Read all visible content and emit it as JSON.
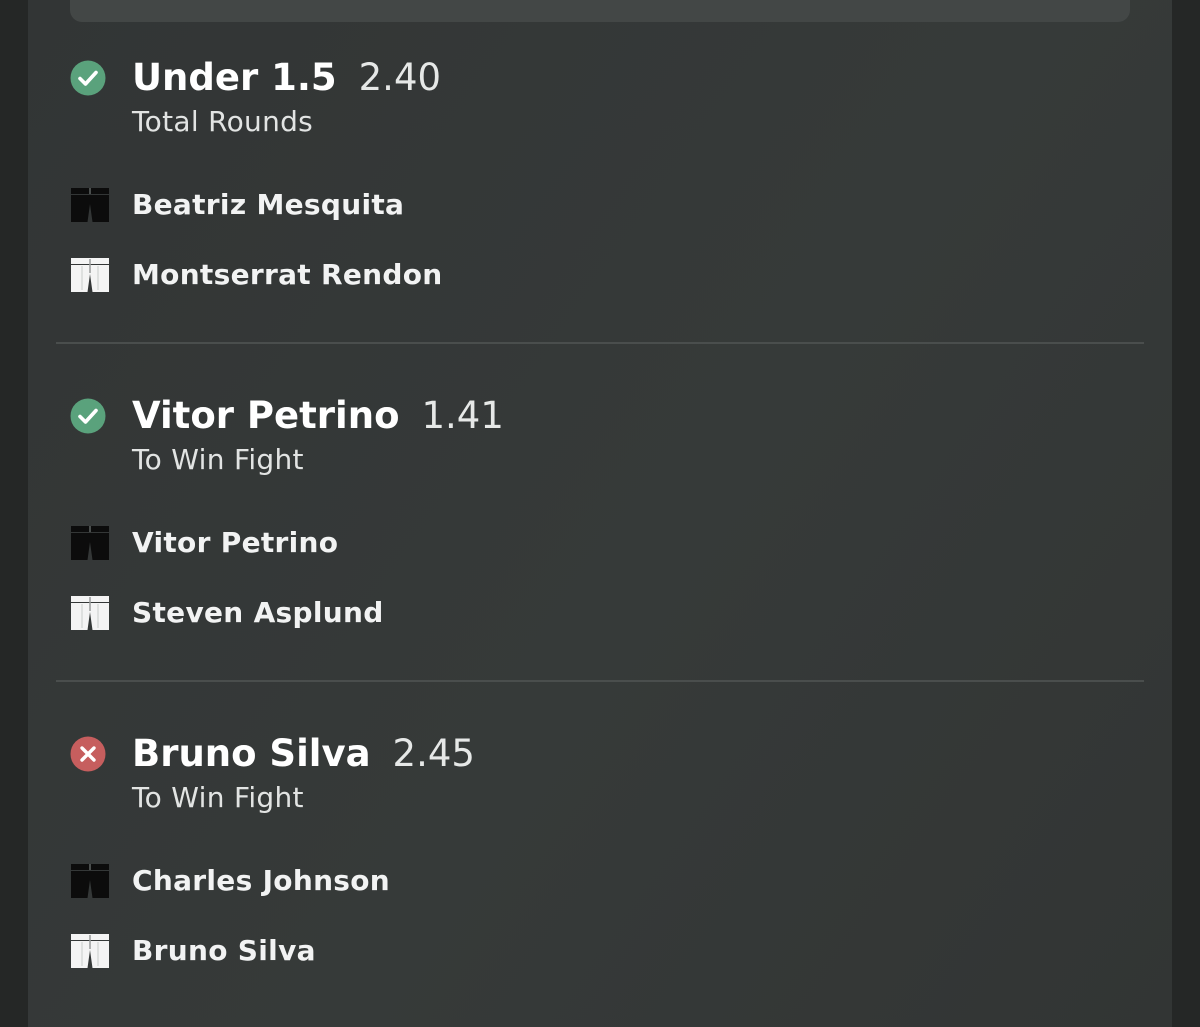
{
  "selections": [
    {
      "status": "won",
      "name": "Under 1.5",
      "odds": "2.40",
      "market": "Total Rounds",
      "fighters": [
        "Beatriz Mesquita",
        "Montserrat Rendon"
      ]
    },
    {
      "status": "won",
      "name": "Vitor Petrino",
      "odds": "1.41",
      "market": "To Win Fight",
      "fighters": [
        "Vitor Petrino",
        "Steven Asplund"
      ]
    },
    {
      "status": "lost",
      "name": "Bruno Silva",
      "odds": "2.45",
      "market": "To Win Fight",
      "fighters": [
        "Charles Johnson",
        "Bruno Silva"
      ]
    }
  ],
  "icons": {
    "won": "check-circle-icon",
    "lost": "cross-circle-icon",
    "corner_1": "black-trunks-icon",
    "corner_2": "white-trunks-icon"
  },
  "colors": {
    "won": "#5aa27c",
    "lost": "#c65e5e",
    "background": "#343837",
    "text": "#ffffff"
  }
}
